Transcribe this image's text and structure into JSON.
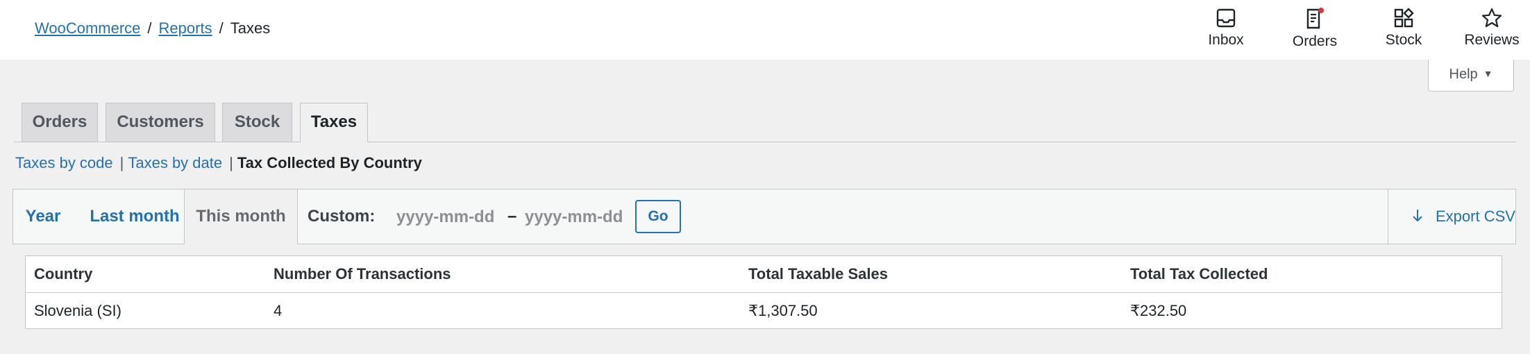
{
  "breadcrumb": {
    "root": "WooCommerce",
    "parent": "Reports",
    "current": "Taxes",
    "sep": "/"
  },
  "header_actions": [
    {
      "label": "Inbox",
      "icon": "inbox-icon"
    },
    {
      "label": "Orders",
      "icon": "orders-icon"
    },
    {
      "label": "Stock",
      "icon": "stock-icon"
    },
    {
      "label": "Reviews",
      "icon": "star-icon"
    }
  ],
  "help": {
    "label": "Help",
    "caret": "▼"
  },
  "tabs": [
    {
      "label": "Orders"
    },
    {
      "label": "Customers"
    },
    {
      "label": "Stock"
    },
    {
      "label": "Taxes",
      "active": true
    }
  ],
  "subsub": {
    "taxes_by_code": "Taxes by code",
    "taxes_by_date": "Taxes by date",
    "current": "Tax Collected By Country",
    "pipe": "|"
  },
  "range": {
    "year": "Year",
    "last_month": "Last month",
    "this_month": "This month",
    "custom_label": "Custom:",
    "start_placeholder": "yyyy-mm-dd",
    "end_placeholder": "yyyy-mm-dd",
    "dash": "–",
    "go": "Go",
    "export": "Export CSV"
  },
  "table": {
    "headers": [
      "Country",
      "Number Of Transactions",
      "Total Taxable Sales",
      "Total Tax Collected"
    ],
    "rows": [
      [
        "Slovenia (SI)",
        "4",
        "₹1,307.50",
        "₹232.50"
      ]
    ]
  },
  "colors": {
    "accent": "#2271b1",
    "notification": "#d63638"
  }
}
